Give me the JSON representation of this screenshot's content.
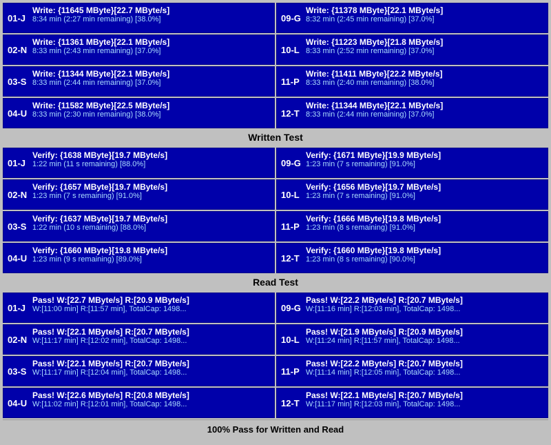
{
  "sections": {
    "write": {
      "rows": [
        {
          "left": {
            "id": "01-J",
            "line1": "Write: {11645 MByte}[22.7 MByte/s]",
            "line2": "8:34 min (2:27 min remaining)  [38.0%]"
          },
          "right": {
            "id": "09-G",
            "line1": "Write: {11378 MByte}[22.1 MByte/s]",
            "line2": "8:32 min (2:45 min remaining)  [37.0%]"
          }
        },
        {
          "left": {
            "id": "02-N",
            "line1": "Write: {11361 MByte}[22.1 MByte/s]",
            "line2": "8:33 min (2:43 min remaining)  [37.0%]"
          },
          "right": {
            "id": "10-L",
            "line1": "Write: {11223 MByte}[21.8 MByte/s]",
            "line2": "8:33 min (2:52 min remaining)  [37.0%]"
          }
        },
        {
          "left": {
            "id": "03-S",
            "line1": "Write: {11344 MByte}[22.1 MByte/s]",
            "line2": "8:33 min (2:44 min remaining)  [37.0%]"
          },
          "right": {
            "id": "11-P",
            "line1": "Write: {11411 MByte}[22.2 MByte/s]",
            "line2": "8:33 min (2:40 min remaining)  [38.0%]"
          }
        },
        {
          "left": {
            "id": "04-U",
            "line1": "Write: {11582 MByte}[22.5 MByte/s]",
            "line2": "8:33 min (2:30 min remaining)  [38.0%]"
          },
          "right": {
            "id": "12-T",
            "line1": "Write: {11344 MByte}[22.1 MByte/s]",
            "line2": "8:33 min (2:44 min remaining)  [37.0%]"
          }
        }
      ],
      "header": "Written Test"
    },
    "verify": {
      "rows": [
        {
          "left": {
            "id": "01-J",
            "line1": "Verify: {1638 MByte}[19.7 MByte/s]",
            "line2": "1:22 min (11 s remaining)   [88.0%]"
          },
          "right": {
            "id": "09-G",
            "line1": "Verify: {1671 MByte}[19.9 MByte/s]",
            "line2": "1:23 min (7 s remaining)   [91.0%]"
          }
        },
        {
          "left": {
            "id": "02-N",
            "line1": "Verify: {1657 MByte}[19.7 MByte/s]",
            "line2": "1:23 min (7 s remaining)   [91.0%]"
          },
          "right": {
            "id": "10-L",
            "line1": "Verify: {1656 MByte}[19.7 MByte/s]",
            "line2": "1:23 min (7 s remaining)   [91.0%]"
          }
        },
        {
          "left": {
            "id": "03-S",
            "line1": "Verify: {1637 MByte}[19.7 MByte/s]",
            "line2": "1:22 min (10 s remaining)   [88.0%]"
          },
          "right": {
            "id": "11-P",
            "line1": "Verify: {1666 MByte}[19.8 MByte/s]",
            "line2": "1:23 min (8 s remaining)   [91.0%]"
          }
        },
        {
          "left": {
            "id": "04-U",
            "line1": "Verify: {1660 MByte}[19.8 MByte/s]",
            "line2": "1:23 min (9 s remaining)   [89.0%]"
          },
          "right": {
            "id": "12-T",
            "line1": "Verify: {1660 MByte}[19.8 MByte/s]",
            "line2": "1:23 min (8 s remaining)   [90.0%]"
          }
        }
      ],
      "header": "Read Test"
    },
    "pass": {
      "rows": [
        {
          "left": {
            "id": "01-J",
            "line1": "Pass! W:[22.7 MByte/s] R:[20.9 MByte/s]",
            "line2": "W:[11:00 min] R:[11:57 min], TotalCap: 1498..."
          },
          "right": {
            "id": "09-G",
            "line1": "Pass! W:[22.2 MByte/s] R:[20.7 MByte/s]",
            "line2": "W:[11:16 min] R:[12:03 min], TotalCap: 1498..."
          }
        },
        {
          "left": {
            "id": "02-N",
            "line1": "Pass! W:[22.1 MByte/s] R:[20.7 MByte/s]",
            "line2": "W:[11:17 min] R:[12:02 min], TotalCap: 1498..."
          },
          "right": {
            "id": "10-L",
            "line1": "Pass! W:[21.9 MByte/s] R:[20.9 MByte/s]",
            "line2": "W:[11:24 min] R:[11:57 min], TotalCap: 1498..."
          }
        },
        {
          "left": {
            "id": "03-S",
            "line1": "Pass! W:[22.1 MByte/s] R:[20.7 MByte/s]",
            "line2": "W:[11:17 min] R:[12:04 min], TotalCap: 1498..."
          },
          "right": {
            "id": "11-P",
            "line1": "Pass! W:[22.2 MByte/s] R:[20.7 MByte/s]",
            "line2": "W:[11:14 min] R:[12:05 min], TotalCap: 1498..."
          }
        },
        {
          "left": {
            "id": "04-U",
            "line1": "Pass! W:[22.6 MByte/s] R:[20.8 MByte/s]",
            "line2": "W:[11:02 min] R:[12:01 min], TotalCap: 1498..."
          },
          "right": {
            "id": "12-T",
            "line1": "Pass! W:[22.1 MByte/s] R:[20.7 MByte/s]",
            "line2": "W:[11:17 min] R:[12:03 min], TotalCap: 1498..."
          }
        }
      ],
      "header": "Read Test"
    },
    "footer": "100% Pass for Written and Read"
  }
}
